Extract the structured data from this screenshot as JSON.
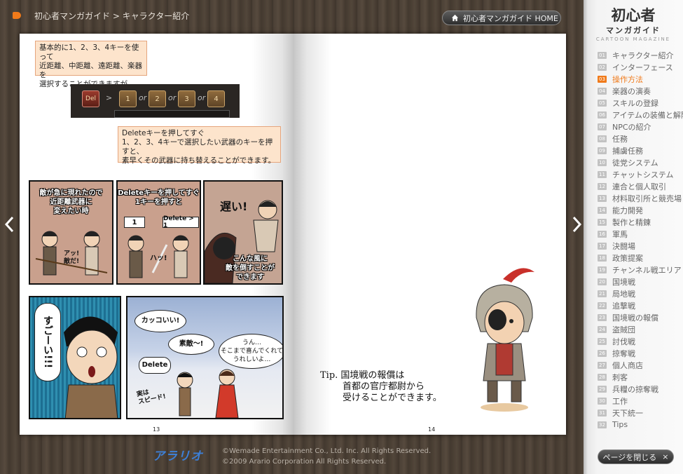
{
  "header": {
    "breadcrumb": "初心者マンガガイド > キャラクター紹介",
    "home_button": "初心者マンガガイド HOME",
    "accent_color": "#f07a1a"
  },
  "page_left": {
    "note1": [
      "基本的に1、2、3、4キーを使って",
      "近距離、中距離、遠距離、楽器を",
      "選択することができますが"
    ],
    "keys": {
      "del": "Del",
      "k1": "1",
      "k2": "2",
      "k3": "3",
      "k4": "4",
      "or": "or",
      "gt": ">"
    },
    "note2": [
      "Deleteキーを押してすぐ",
      "1、2、3、4キーで選択したい武器のキーを押すと、",
      "素早くその武器に持ち替えることができます。"
    ],
    "comic": {
      "panel1_caption": [
        "敵が急に現れたので",
        "近距離武器に",
        "変えたい時"
      ],
      "panel1_sfx": [
        "アッ!",
        "敵だ!"
      ],
      "panel2_caption": [
        "Deleteキーを押してすぐ",
        "1キーを押すと"
      ],
      "panel2_tag1": "1",
      "panel2_tag2": "Delete > 1",
      "panel2_sfx": "ハッ!",
      "panel3_sfx": "遅い!",
      "panel3_caption": [
        "こんな風に",
        "敵を倒すことが",
        "できます"
      ],
      "panel4_shout": "すごーい!!!",
      "panel5_b1": "カッコいい!",
      "panel5_b2": "素敵〜!",
      "panel5_b3": "Delete",
      "panel5_b4": [
        "うん…",
        "そこまで喜んでくれて",
        "うれしいよ…"
      ],
      "panel5_sfx": [
        "実は",
        "スピード!"
      ]
    },
    "page_number": "13"
  },
  "page_right": {
    "tip": [
      "Tip. 国境戦の報償は",
      "首都の官庁都尉から",
      "受けることができます。"
    ],
    "page_number": "14"
  },
  "footer": {
    "logo": "アラリオ",
    "copyright": [
      "©Wemade Entertainment Co., Ltd. Inc. All Rights Reserved.",
      "©2009 Arario Corporation All Rights Reserved."
    ]
  },
  "sidebar": {
    "title": "初心者",
    "subtitle": "マンガガイド",
    "subtitle_en": "CARTOON MAGAZINE",
    "active_index": 2,
    "items": [
      {
        "num": "01",
        "label": "キャラクター紹介"
      },
      {
        "num": "02",
        "label": "インターフェース"
      },
      {
        "num": "03",
        "label": "操作方法"
      },
      {
        "num": "04",
        "label": "楽器の演奏"
      },
      {
        "num": "05",
        "label": "スキルの登録"
      },
      {
        "num": "06",
        "label": "アイテムの装備と解除"
      },
      {
        "num": "07",
        "label": "NPCの紹介"
      },
      {
        "num": "08",
        "label": "任務"
      },
      {
        "num": "09",
        "label": "捕虜任務"
      },
      {
        "num": "10",
        "label": "徒党システム"
      },
      {
        "num": "11",
        "label": "チャットシステム"
      },
      {
        "num": "12",
        "label": "連合と個人取引"
      },
      {
        "num": "13",
        "label": "材料取引所と競売場"
      },
      {
        "num": "14",
        "label": "能力開発"
      },
      {
        "num": "15",
        "label": "製作と精錬"
      },
      {
        "num": "16",
        "label": "軍馬"
      },
      {
        "num": "17",
        "label": "決闘場"
      },
      {
        "num": "18",
        "label": "政策提案"
      },
      {
        "num": "19",
        "label": "チャンネル戦エリア"
      },
      {
        "num": "20",
        "label": "国境戦"
      },
      {
        "num": "21",
        "label": "局地戦"
      },
      {
        "num": "22",
        "label": "追撃戦"
      },
      {
        "num": "23",
        "label": "国境戦の報償"
      },
      {
        "num": "24",
        "label": "盗賊団"
      },
      {
        "num": "25",
        "label": "討伐戦"
      },
      {
        "num": "26",
        "label": "掠奪戦"
      },
      {
        "num": "27",
        "label": "個人商店"
      },
      {
        "num": "28",
        "label": "刺客"
      },
      {
        "num": "29",
        "label": "兵糧の掠奪戦"
      },
      {
        "num": "30",
        "label": "工作"
      },
      {
        "num": "31",
        "label": "天下統一"
      },
      {
        "num": "32",
        "label": "Tips"
      }
    ],
    "close_button": "ページを閉じる",
    "close_icon": "×"
  }
}
